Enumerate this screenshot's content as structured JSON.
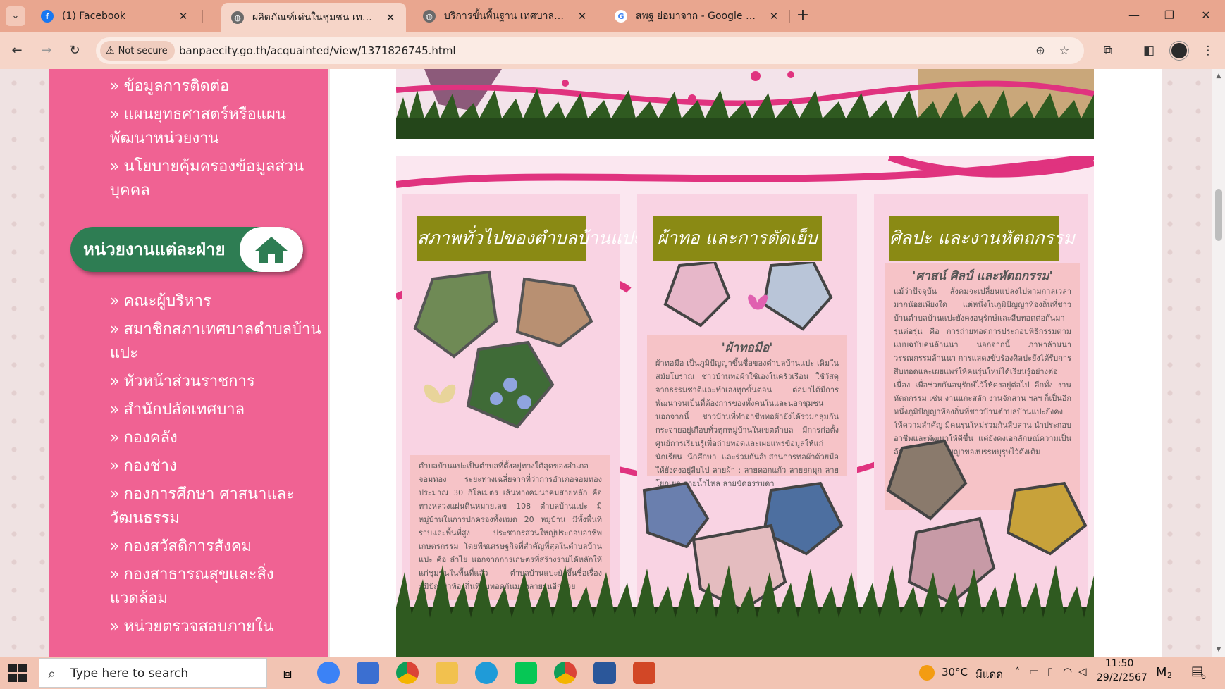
{
  "browser": {
    "tabs": [
      {
        "title": "(1) Facebook",
        "icon": "facebook-icon",
        "active": false
      },
      {
        "title": "ผลิตภัณฑ์เด่นในชุมชน เทศบาลตำบล",
        "icon": "globe-icon",
        "active": true
      },
      {
        "title": "บริการขั้นพื้นฐาน เทศบาลตำบลบ้าน",
        "icon": "globe-icon",
        "active": false
      },
      {
        "title": "สพฐ ย่อมาจาก - Google Search",
        "icon": "google-icon",
        "active": false
      }
    ],
    "security_label": "Not secure",
    "url": "banpaecity.go.th/acquainted/view/1371826745.html"
  },
  "sidebar": {
    "items_top": [
      "ข้อมูลการติดต่อ",
      "แผนยุทธศาสตร์หรือแผนพัฒนาหน่วยงาน",
      "นโยบายคุ้มครองข้อมูลส่วนบุคคล"
    ],
    "section_title": "หน่วยงานแต่ละฝ่าย",
    "items": [
      "คณะผู้บริหาร",
      "สมาชิกสภาเทศบาลตำบลบ้านแปะ",
      "หัวหน้าส่วนราชการ",
      "สำนักปลัดเทศบาล",
      "กองคลัง",
      "กองช่าง",
      "กองการศึกษา ศาสนาและวัฒนธรรม",
      "กองสวัสดิการสังคม",
      "กองสาธารณสุขและสิ่งแวดล้อม",
      "หน่วยตรวจสอบภายใน"
    ]
  },
  "brochure": {
    "panels": [
      {
        "heading": "สภาพทั่วไปของตำบลบ้านแปะ",
        "subheading": "",
        "text": "ตำบลบ้านแปะเป็นตำบลที่ตั้งอยู่ทางใต้สุดของอำเภอจอมทอง ระยะทางเฉลี่ยจากที่ว่าการอำเภอจอมทองประมาณ 30 กิโลเมตร เส้นทางคมนาคมสายหลัก คือ ทางหลวงแผ่นดินหมายเลข 108 ตำบลบ้านแปะ มีหมู่บ้านในการปกครองทั้งหมด 20 หมู่บ้าน มีทั้งพื้นที่ราบและพื้นที่สูง ประชากรส่วนใหญ่ประกอบอาชีพเกษตรกรรม โดยพืชเศรษฐกิจที่สำคัญที่สุดในตำบลบ้านแปะ คือ ลำไย นอกจากการเกษตรที่สร้างรายได้หลักให้แก่ชุมชนในพื้นที่แล้ว ตำบลบ้านแปะยังขึ้นชื่อเรื่องภูมิปัญญาท้องถิ่นที่สืบทอดกันมาหลายรุ่นอีกด้วย"
      },
      {
        "heading": "ผ้าทอ และการตัดเย็บ",
        "subheading": "'ผ้าทอมือ'",
        "text": "ผ้าทอมือ เป็นภูมิปัญญาขึ้นชื่อของตำบลบ้านแปะ เดิมในสมัยโบราณ ชาวบ้านทอผ้าใช้เองในครัวเรือน ใช้วัสดุจากธรรมชาติและทำเองทุกขั้นตอน ต่อมาได้มีการพัฒนาจนเป็นที่ต้องการของทั้งคนในและนอกชุมชน นอกจากนี้ ชาวบ้านที่ทำอาชีพทอผ้ายังได้รวมกลุ่มกันกระจายอยู่เกือบทั่วทุกหมู่บ้านในเขตตำบล มีการก่อตั้งศูนย์การเรียนรู้เพื่อถ่ายทอดและเผยแพร่ข้อมูลให้แก่นักเรียน นักศึกษา และร่วมกันสืบสานการทอผ้าด้วยมือให้ยังคงอยู่สืบไป ลายผ้า : ลายดอกแก้ว ลายยกมุก ลายโยกเยก ลายน้ำไหล ลายขัดธรรมดา"
      },
      {
        "heading": "ศิลปะ และงานหัตถกรรม",
        "subheading": "'ศาสน์ ศิลป์ และหัตถกรรม'",
        "text": "แม้ว่าปัจจุบัน สังคมจะเปลี่ยนแปลงไปตามกาลเวลามากน้อยเพียงใด แต่หนึ่งในภูมิปัญญาท้องถิ่นที่ชาวบ้านตำบลบ้านแปะยังคงอนุรักษ์และสืบทอดต่อกันมารุ่นต่อรุ่น คือ การถ่ายทอดการประกอบพิธีกรรมตามแบบฉบับคนล้านนา นอกจากนี้ ภาษาล้านนา วรรณกรรมล้านนา การแสดงขับร้องศิลปะยังได้รับการสืบทอดและเผยแพร่ให้คนรุ่นใหม่ได้เรียนรู้อย่างต่อเนื่อง เพื่อช่วยกันอนุรักษ์ไว้ให้คงอยู่ต่อไป อีกทั้ง งานหัตถกรรม เช่น งานแกะสลัก งานจักสาน ฯลฯ ก็เป็นอีกหนึ่งภูมิปัญญาท้องถิ่นที่ชาวบ้านตำบลบ้านแปะยังคงให้ความสำคัญ มีคนรุ่นใหม่ร่วมกันสืบสาน นำประกอบอาชีพและพัฒนาให้ดีขึ้น แต่ยังคงเอกลักษณ์ความเป็นล้านนาและภูมิปัญญาของบรรพบุรุษไว้ดังเดิม"
      }
    ]
  },
  "taskbar": {
    "search_placeholder": "Type here to search",
    "weather": "30°C",
    "weather_desc": "มีแดด",
    "time": "11:50",
    "date": "29/2/2567",
    "notification_count": "6",
    "widgets_count": "2"
  },
  "colors": {
    "sidebar": "#f06293",
    "section_pill": "#2e7d53",
    "panel_heading": "#8a8a14",
    "tabbar": "#e9a68f"
  }
}
